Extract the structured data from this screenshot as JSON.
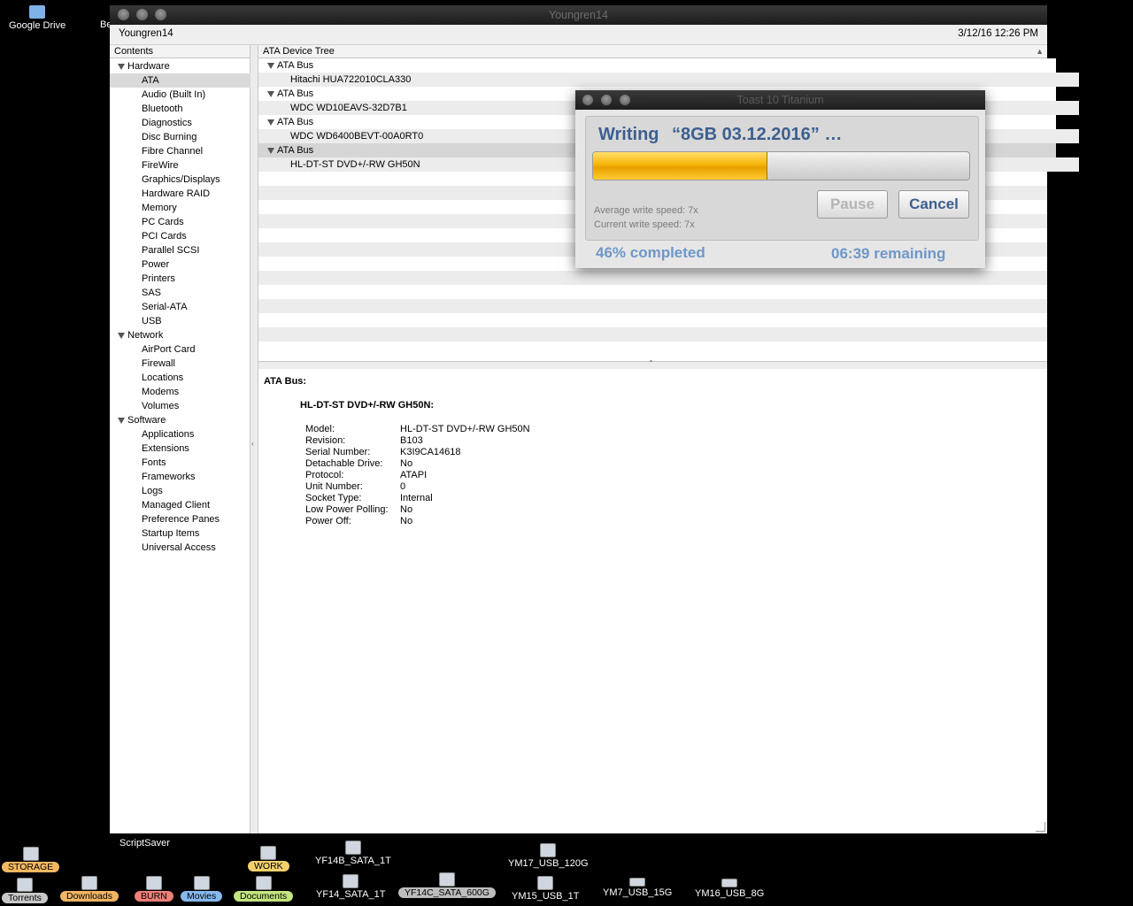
{
  "desktop": {
    "top_icons": [
      {
        "label": "Google Drive"
      },
      {
        "label": "Be"
      }
    ],
    "scriptsaver": "ScriptSaver",
    "bottom_row1": [
      {
        "label": "STORAGE",
        "color": "#f6b861"
      },
      {
        "label": "WORK",
        "color": "#f2d06b"
      },
      {
        "label": "YF14B_SATA_1T"
      },
      {
        "label": "YM17_USB_120G"
      }
    ],
    "bottom_row2": [
      {
        "label": "Torrents",
        "color": "#c8c8c8"
      },
      {
        "label": "Downloads",
        "color": "#f0b463"
      },
      {
        "label": "BURN",
        "color": "#ef7f78"
      },
      {
        "label": "Movies",
        "color": "#86b9ef"
      },
      {
        "label": "Documents",
        "color": "#c4e57f"
      },
      {
        "label": "YF14_SATA_1T"
      },
      {
        "label": "YF14C_SATA_600G",
        "color": "#bdbdbd"
      },
      {
        "label": "YM15_USB_1T"
      },
      {
        "label": "YM7_USB_15G"
      },
      {
        "label": "YM16_USB_8G"
      }
    ]
  },
  "window": {
    "title": "Youngren14",
    "computer_name": "Youngren14",
    "datetime": "3/12/16 12:26 PM"
  },
  "sidebar": {
    "header": "Contents",
    "rows": [
      {
        "label": "Hardware",
        "level": 0,
        "expanded": true
      },
      {
        "label": "ATA",
        "level": 1,
        "selected": true
      },
      {
        "label": "Audio (Built In)",
        "level": 1
      },
      {
        "label": "Bluetooth",
        "level": 1
      },
      {
        "label": "Diagnostics",
        "level": 1
      },
      {
        "label": "Disc Burning",
        "level": 1
      },
      {
        "label": "Fibre Channel",
        "level": 1
      },
      {
        "label": "FireWire",
        "level": 1
      },
      {
        "label": "Graphics/Displays",
        "level": 1
      },
      {
        "label": "Hardware RAID",
        "level": 1
      },
      {
        "label": "Memory",
        "level": 1
      },
      {
        "label": "PC Cards",
        "level": 1
      },
      {
        "label": "PCI Cards",
        "level": 1
      },
      {
        "label": "Parallel SCSI",
        "level": 1
      },
      {
        "label": "Power",
        "level": 1
      },
      {
        "label": "Printers",
        "level": 1
      },
      {
        "label": "SAS",
        "level": 1
      },
      {
        "label": "Serial-ATA",
        "level": 1
      },
      {
        "label": "USB",
        "level": 1
      },
      {
        "label": "Network",
        "level": 0,
        "expanded": true
      },
      {
        "label": "AirPort Card",
        "level": 1
      },
      {
        "label": "Firewall",
        "level": 1
      },
      {
        "label": "Locations",
        "level": 1
      },
      {
        "label": "Modems",
        "level": 1
      },
      {
        "label": "Volumes",
        "level": 1
      },
      {
        "label": "Software",
        "level": 0,
        "expanded": true
      },
      {
        "label": "Applications",
        "level": 1
      },
      {
        "label": "Extensions",
        "level": 1
      },
      {
        "label": "Fonts",
        "level": 1
      },
      {
        "label": "Frameworks",
        "level": 1
      },
      {
        "label": "Logs",
        "level": 1
      },
      {
        "label": "Managed Client",
        "level": 1
      },
      {
        "label": "Preference Panes",
        "level": 1
      },
      {
        "label": "Startup Items",
        "level": 1
      },
      {
        "label": "Universal Access",
        "level": 1
      }
    ]
  },
  "tree": {
    "header": "ATA Device Tree",
    "rows": [
      {
        "label": "ATA Bus",
        "level": 0
      },
      {
        "label": "Hitachi HUA722010CLA330",
        "level": 1
      },
      {
        "label": "ATA Bus",
        "level": 0
      },
      {
        "label": "WDC WD10EAVS-32D7B1",
        "level": 1
      },
      {
        "label": "ATA Bus",
        "level": 0
      },
      {
        "label": "WDC WD6400BEVT-00A0RT0",
        "level": 1
      },
      {
        "label": "ATA Bus",
        "level": 0,
        "selected": true
      },
      {
        "label": "HL-DT-ST DVD+/-RW GH50N",
        "level": 1
      }
    ]
  },
  "detail": {
    "section": "ATA Bus:",
    "device": "HL-DT-ST DVD+/-RW GH50N:",
    "fields": [
      {
        "key": "Model:",
        "value": "HL-DT-ST DVD+/-RW GH50N"
      },
      {
        "key": "Revision:",
        "value": "B103"
      },
      {
        "key": "Serial Number:",
        "value": "K3I9CA14618"
      },
      {
        "key": "Detachable Drive:",
        "value": "No"
      },
      {
        "key": "Protocol:",
        "value": "ATAPI"
      },
      {
        "key": "Unit Number:",
        "value": "0"
      },
      {
        "key": "Socket Type:",
        "value": "Internal"
      },
      {
        "key": "Low Power Polling:",
        "value": "No"
      },
      {
        "key": "Power Off:",
        "value": "No"
      }
    ]
  },
  "toast": {
    "title": "Toast 10 Titanium",
    "status": "Writing",
    "disc_name": "“8GB 03.12.2016” …",
    "progress": 0.46,
    "pause_label": "Pause",
    "cancel_label": "Cancel",
    "avg_speed": "Average write speed: 7x",
    "cur_speed": "Current write speed: 7x",
    "completed": "46% completed",
    "remaining": "06:39 remaining",
    "accent_color": "#6f97c8"
  }
}
